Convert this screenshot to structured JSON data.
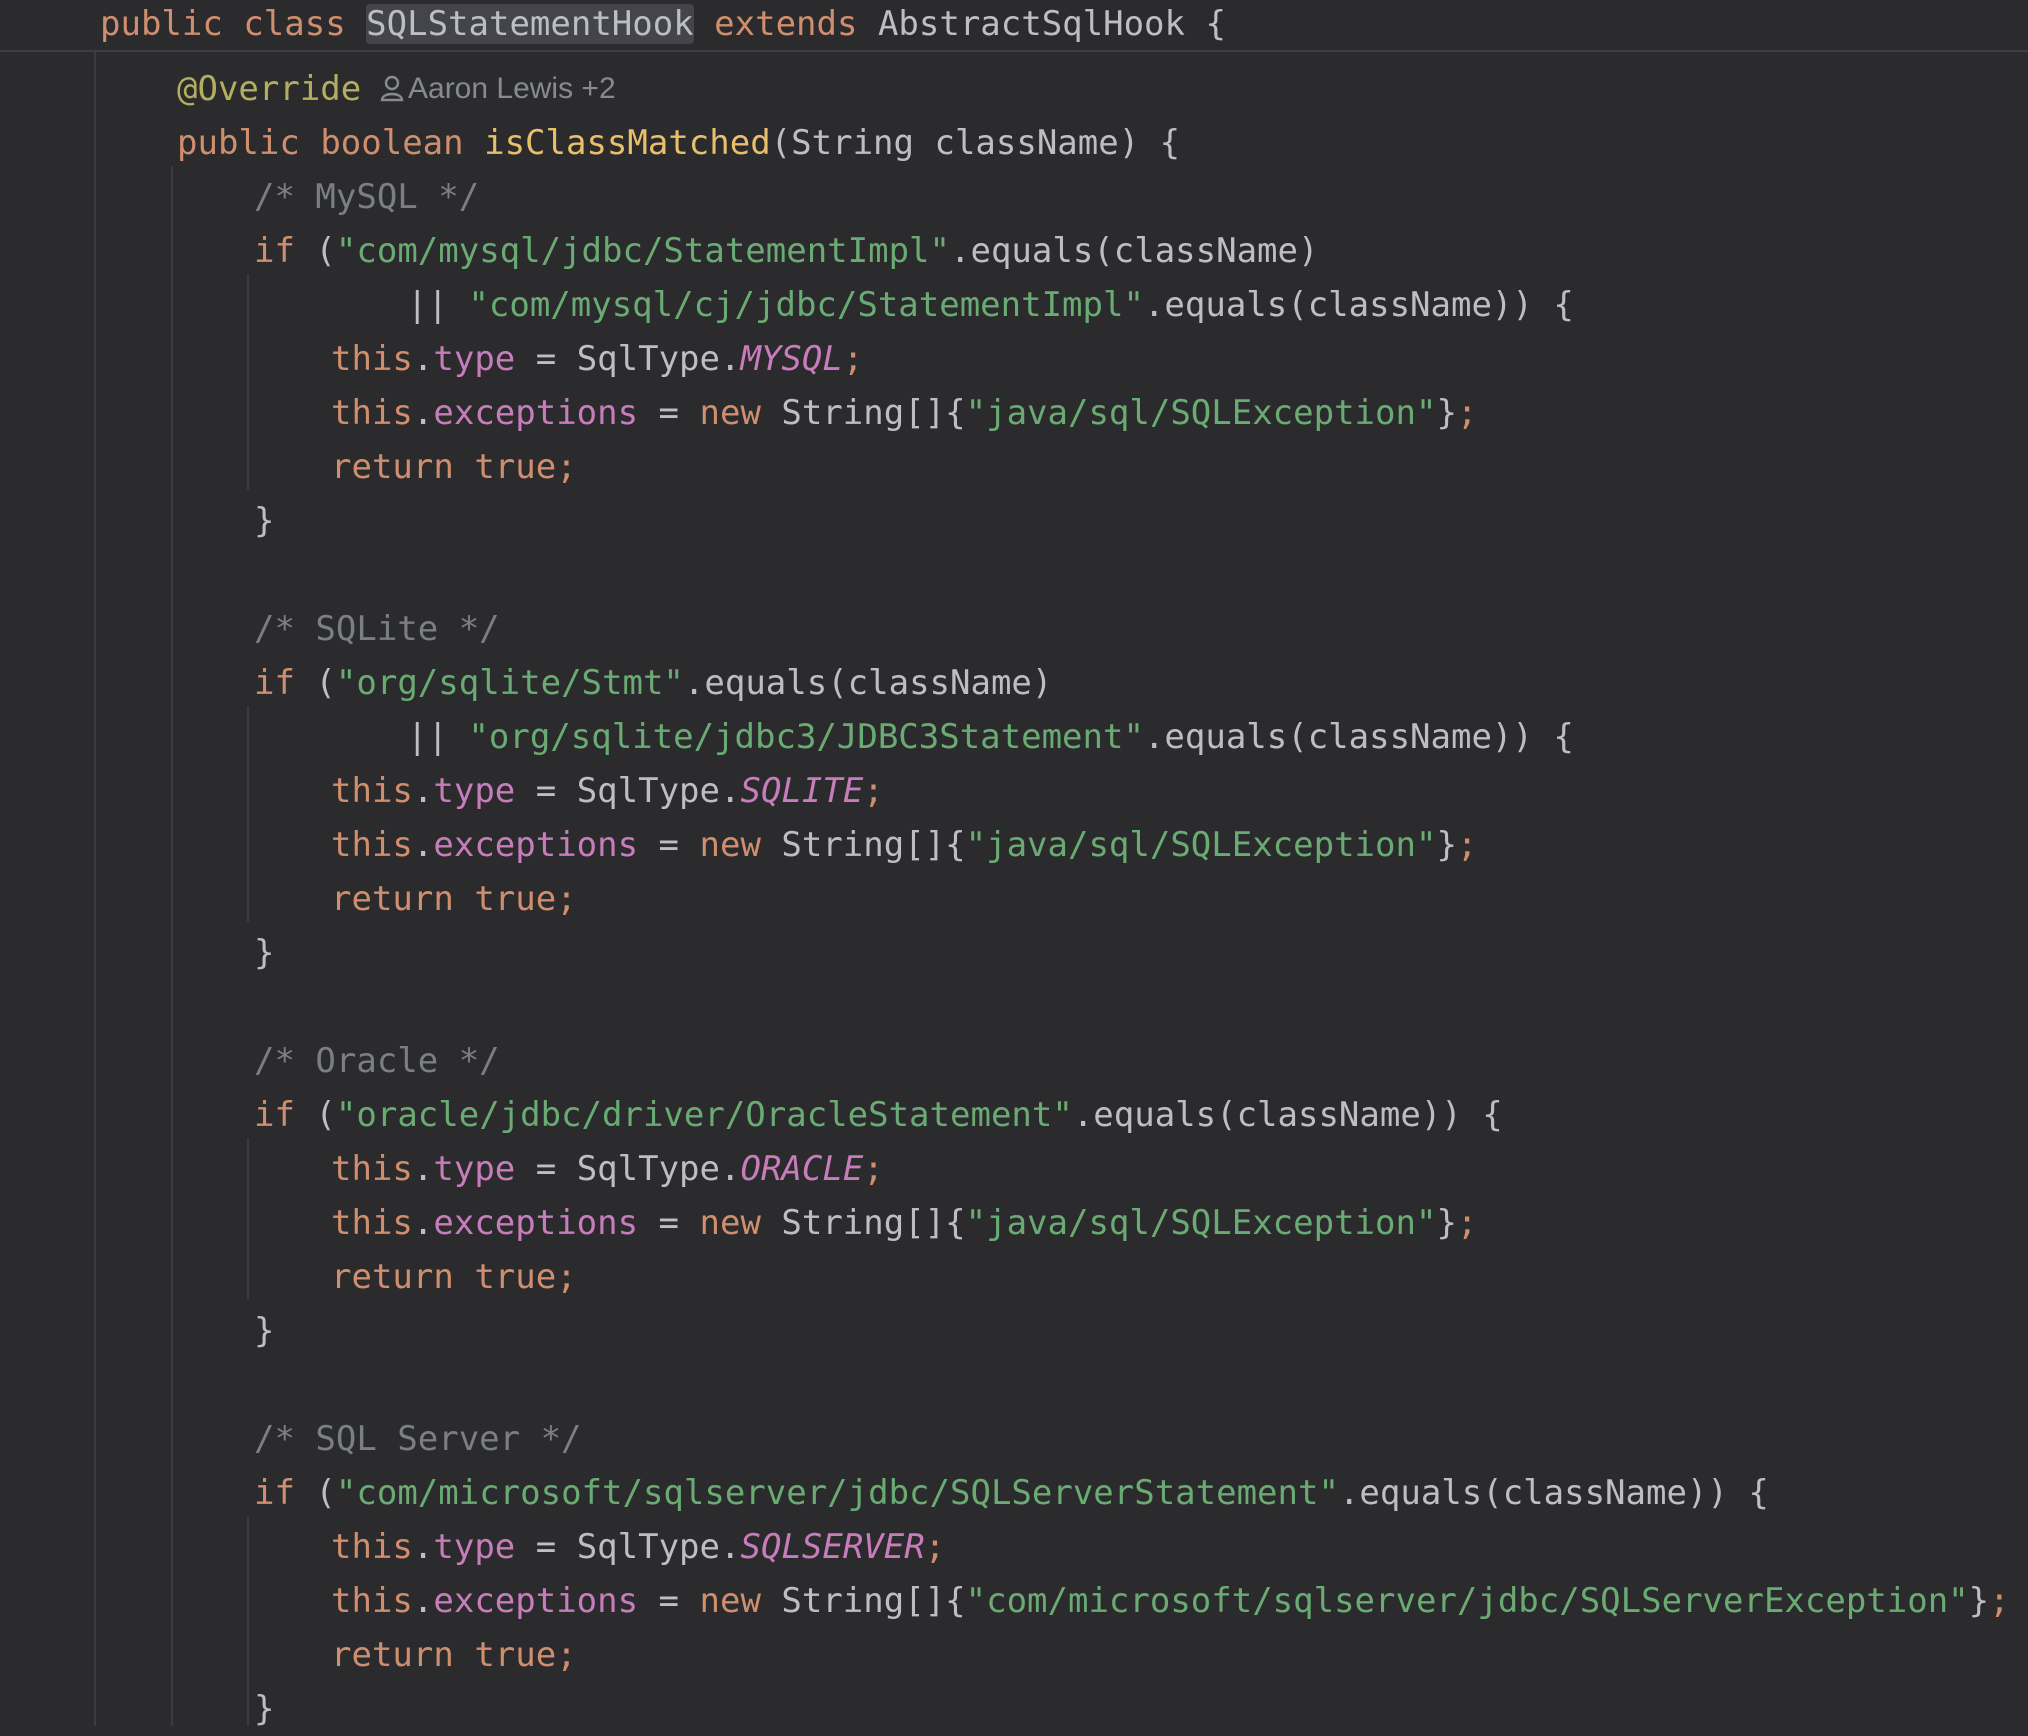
{
  "header": {
    "kw_public": "public",
    "kw_class": "class",
    "class_name": "SQLStatementHook",
    "kw_extends": "extends",
    "super_class": "AbstractSqlHook",
    "brace": "{"
  },
  "method": {
    "annotation": "@Override",
    "author_hint": "Aaron Lewis +2",
    "kw_public": "public",
    "kw_boolean": "boolean",
    "name": "isClassMatched",
    "param_type": "String",
    "param_name": "className",
    "sig_tail": ") {",
    "open_paren": "("
  },
  "blocks": [
    {
      "comment": "/* MySQL */",
      "cond_str": "\"com/mysql/jdbc/StatementImpl\"",
      "cond_tail": ".equals(className)",
      "or_str": "\"com/mysql/cj/jdbc/StatementImpl\"",
      "or_tail": ".equals(className)) {",
      "type_const": "MYSQL",
      "exception": "\"java/sql/SQLException\""
    },
    {
      "comment": "/* SQLite */",
      "cond_str": "\"org/sqlite/Stmt\"",
      "cond_tail": ".equals(className)",
      "or_str": "\"org/sqlite/jdbc3/JDBC3Statement\"",
      "or_tail": ".equals(className)) {",
      "type_const": "SQLITE",
      "exception": "\"java/sql/SQLException\""
    },
    {
      "comment": "/* Oracle */",
      "cond_str": "\"oracle/jdbc/driver/OracleStatement\"",
      "cond_tail": ".equals(className)) {",
      "type_const": "ORACLE",
      "exception": "\"java/sql/SQLException\""
    },
    {
      "comment": "/* SQL Server */",
      "cond_str": "\"com/microsoft/sqlserver/jdbc/SQLServerStatement\"",
      "cond_tail": ".equals(className)) {",
      "type_const": "SQLSERVER",
      "exception": "\"com/microsoft/sqlserver/jdbc/SQLServerException\""
    }
  ],
  "common": {
    "kw_if": "if",
    "open_paren": " (",
    "or_op": "|| ",
    "kw_this": "this",
    "dot": ".",
    "field_type": "type",
    "assign": " = ",
    "sqltype": "SqlType",
    "semi": ";",
    "field_exceptions": "exceptions",
    "kw_new": "new",
    "string_arr": " String[]{",
    "close_arr": "}",
    "kw_return": "return",
    "kw_true": "true",
    "close_brace": "}"
  },
  "colors": {
    "background": "#2b2b2d",
    "keyword": "#cf8e6d",
    "string": "#6aab73",
    "comment": "#7a7e85",
    "annotation": "#b3ae60",
    "method_decl": "#e8bf6a",
    "field": "#c77dbb",
    "text": "#bcbec4"
  }
}
